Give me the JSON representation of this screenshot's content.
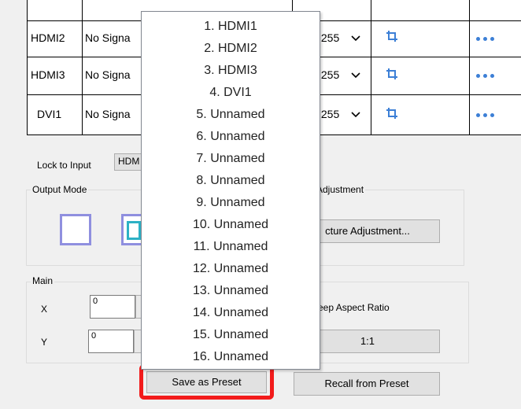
{
  "table": {
    "rows": [
      {
        "input": "HDMI2",
        "signal": "No Signa",
        "value": ":255"
      },
      {
        "input": "HDMI3",
        "signal": "No Signa",
        "value": ":255"
      },
      {
        "input": "DVI1",
        "signal": "No Signa",
        "value": ":255"
      }
    ]
  },
  "lock_to_input": {
    "label": "Lock to Input",
    "value": "HDM"
  },
  "output_mode": {
    "title": "Output Mode"
  },
  "adjustment": {
    "title": "Adjustment",
    "button": "cture Adjustment..."
  },
  "main": {
    "title": "Main",
    "x_label": "X",
    "x_value": "0",
    "y_label": "Y",
    "y_value": "0",
    "keep_aspect": "eep Aspect Ratio",
    "ratio_button": "1:1"
  },
  "dropdown": {
    "items": [
      "1. HDMI1",
      "2. HDMI2",
      "3. HDMI3",
      "4. DVI1",
      "5. Unnamed",
      "6. Unnamed",
      "7. Unnamed",
      "8. Unnamed",
      "9. Unnamed",
      "10. Unnamed",
      "11. Unnamed",
      "12. Unnamed",
      "13. Unnamed",
      "14. Unnamed",
      "15. Unnamed",
      "16. Unnamed"
    ]
  },
  "buttons": {
    "save_preset": "Save as Preset",
    "recall_preset": "Recall from Preset"
  },
  "colors": {
    "highlight": "#f21b1b",
    "accent": "#3c7fd6",
    "mode_border": "#8f8fdf"
  }
}
